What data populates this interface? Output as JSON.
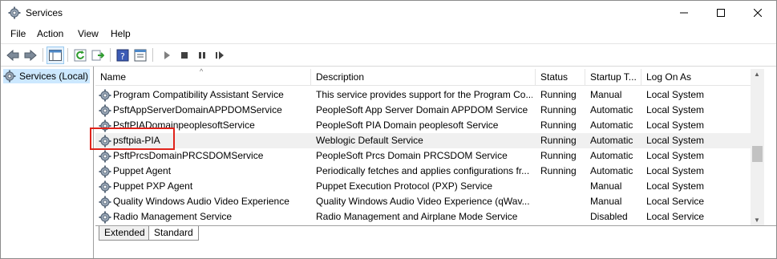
{
  "window": {
    "title": "Services"
  },
  "menu": [
    "File",
    "Action",
    "View",
    "Help"
  ],
  "tree": {
    "root_label": "Services (Local)"
  },
  "columns": [
    "Name",
    "Description",
    "Status",
    "Startup T...",
    "Log On As"
  ],
  "services": [
    {
      "name": "Program Compatibility Assistant Service",
      "description": "This service provides support for the Program Co...",
      "status": "Running",
      "startup": "Manual",
      "logon": "Local System"
    },
    {
      "name": "PsftAppServerDomainAPPDOMService",
      "description": "PeopleSoft App Server Domain APPDOM Service",
      "status": "Running",
      "startup": "Automatic",
      "logon": "Local System"
    },
    {
      "name": "PsftPIADomainpeoplesoftService",
      "description": "PeopleSoft PIA Domain peoplesoft Service",
      "status": "Running",
      "startup": "Automatic",
      "logon": "Local System"
    },
    {
      "name": "psftpia-PIA",
      "description": "Weblogic Default Service",
      "status": "Running",
      "startup": "Automatic",
      "logon": "Local System"
    },
    {
      "name": "PsftPrcsDomainPRCSDOMService",
      "description": "PeopleSoft Prcs Domain PRCSDOM Service",
      "status": "Running",
      "startup": "Automatic",
      "logon": "Local System"
    },
    {
      "name": "Puppet Agent",
      "description": "Periodically fetches and applies configurations fr...",
      "status": "Running",
      "startup": "Automatic",
      "logon": "Local System"
    },
    {
      "name": "Puppet PXP Agent",
      "description": "Puppet Execution Protocol (PXP) Service",
      "status": "",
      "startup": "Manual",
      "logon": "Local System"
    },
    {
      "name": "Quality Windows Audio Video Experience",
      "description": "Quality Windows Audio Video Experience (qWav...",
      "status": "",
      "startup": "Manual",
      "logon": "Local Service"
    },
    {
      "name": "Radio Management Service",
      "description": "Radio Management and Airplane Mode Service",
      "status": "",
      "startup": "Disabled",
      "logon": "Local Service"
    }
  ],
  "selected_index": 3,
  "tabs": [
    "Extended",
    "Standard"
  ],
  "colors": {
    "selection": "#cce8ff",
    "highlight_box": "#e0231b"
  }
}
